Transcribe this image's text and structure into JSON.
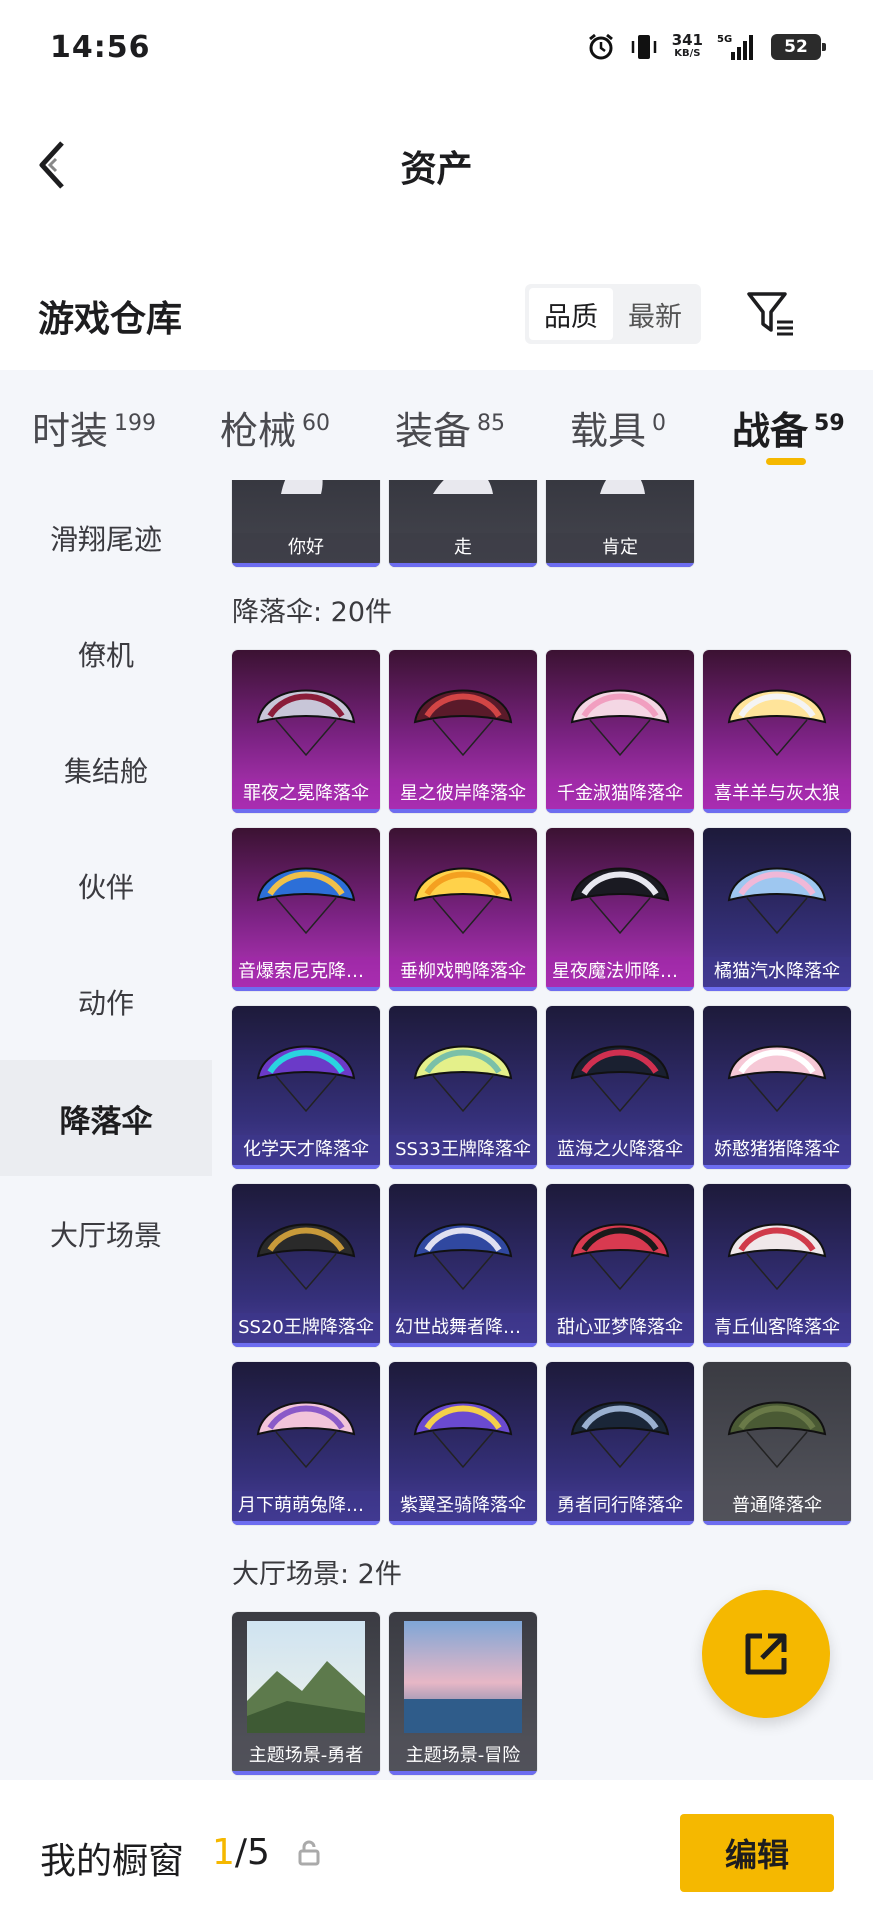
{
  "status_bar": {
    "time": "14:56",
    "net_speed": "341",
    "net_unit": "KB/S",
    "battery": "52"
  },
  "nav": {
    "title": "资产"
  },
  "section": {
    "title": "游戏仓库",
    "sort_options": [
      "品质",
      "最新"
    ]
  },
  "tabs": [
    {
      "label": "时装",
      "count": "199"
    },
    {
      "label": "枪械",
      "count": "60"
    },
    {
      "label": "装备",
      "count": "85"
    },
    {
      "label": "载具",
      "count": "0"
    },
    {
      "label": "战备",
      "count": "59"
    }
  ],
  "sidebar": [
    "滑翔尾迹",
    "僚机",
    "集结舱",
    "伙伴",
    "动作",
    "降落伞",
    "大厅场景"
  ],
  "actions_row": [
    "你好",
    "走",
    "肯定"
  ],
  "parachute_group": {
    "title": "降落伞: 20件"
  },
  "parachutes": [
    {
      "name": "罪夜之冕降落伞",
      "tier": "pink"
    },
    {
      "name": "星之彼岸降落伞",
      "tier": "pink"
    },
    {
      "name": "千金淑猫降落伞",
      "tier": "pink"
    },
    {
      "name": "喜羊羊与灰太狼",
      "tier": "pink"
    },
    {
      "name": "音爆索尼克降落伞",
      "tier": "pink"
    },
    {
      "name": "垂柳戏鸭降落伞",
      "tier": "pink"
    },
    {
      "name": "星夜魔法师降落伞",
      "tier": "pink"
    },
    {
      "name": "橘猫汽水降落伞",
      "tier": "blue"
    },
    {
      "name": "化学天才降落伞",
      "tier": "blue"
    },
    {
      "name": "SS33王牌降落伞",
      "tier": "blue"
    },
    {
      "name": "蓝海之火降落伞",
      "tier": "blue"
    },
    {
      "name": "娇憨猪猪降落伞",
      "tier": "blue"
    },
    {
      "name": "SS20王牌降落伞",
      "tier": "blue"
    },
    {
      "name": "幻世战舞者降落伞",
      "tier": "blue"
    },
    {
      "name": "甜心亚梦降落伞",
      "tier": "blue"
    },
    {
      "name": "青丘仙客降落伞",
      "tier": "blue"
    },
    {
      "name": "月下萌萌兔降落伞",
      "tier": "blue"
    },
    {
      "name": "紫翼圣骑降落伞",
      "tier": "blue"
    },
    {
      "name": "勇者同行降落伞",
      "tier": "blue"
    },
    {
      "name": "普通降落伞",
      "tier": "gray"
    }
  ],
  "lobby_group": {
    "title": "大厅场景: 2件"
  },
  "lobby_scenes": [
    "主题场景-勇者",
    "主题场景-冒险"
  ],
  "bottom": {
    "title": "我的橱窗",
    "current": "1",
    "total": "/5",
    "edit_label": "编辑"
  },
  "colors": {
    "accent": "#f5b800",
    "epic": "#b735bd",
    "rare": "#4a3f9a"
  }
}
